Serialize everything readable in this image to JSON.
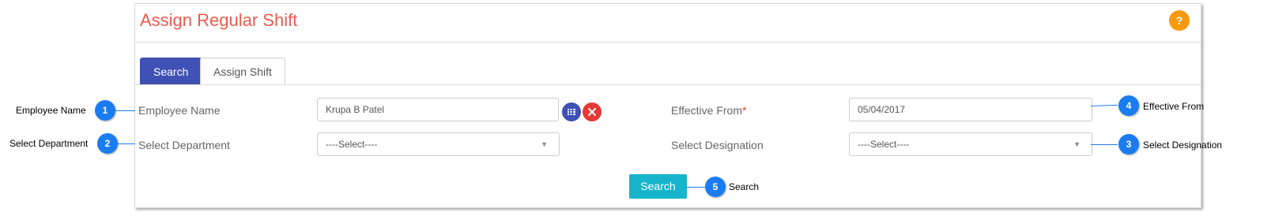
{
  "panel": {
    "title": "Assign Regular Shift",
    "help_label": "?",
    "tabs": [
      {
        "label": "Search"
      },
      {
        "label": "Assign Shift"
      }
    ]
  },
  "form": {
    "employee_name_label": "Employee Name",
    "employee_name_value": "Krupa B Patel",
    "department_label": "Select Department",
    "department_value": "----Select----",
    "effective_from_label": "Effective From",
    "effective_from_required": "*",
    "effective_from_value": "05/04/2017",
    "designation_label": "Select Designation",
    "designation_value": "----Select----",
    "search_button": "Search"
  },
  "annotations": [
    {
      "num": "1",
      "text": "Employee Name"
    },
    {
      "num": "2",
      "text": "Select Department"
    },
    {
      "num": "3",
      "text": "Select Designation"
    },
    {
      "num": "4",
      "text": "Effective From"
    },
    {
      "num": "5",
      "text": "Search"
    }
  ],
  "icons": {
    "list": "list-icon",
    "clear": "clear-icon",
    "dropdown": "chevron-down-icon"
  },
  "colors": {
    "title": "#f05a4f",
    "tab_active": "#3f51b5",
    "help": "#f79a0f",
    "search_button": "#17b5cc",
    "list_button": "#3f51b5",
    "clear_button": "#e53935",
    "callout": "#1a7cf0"
  }
}
